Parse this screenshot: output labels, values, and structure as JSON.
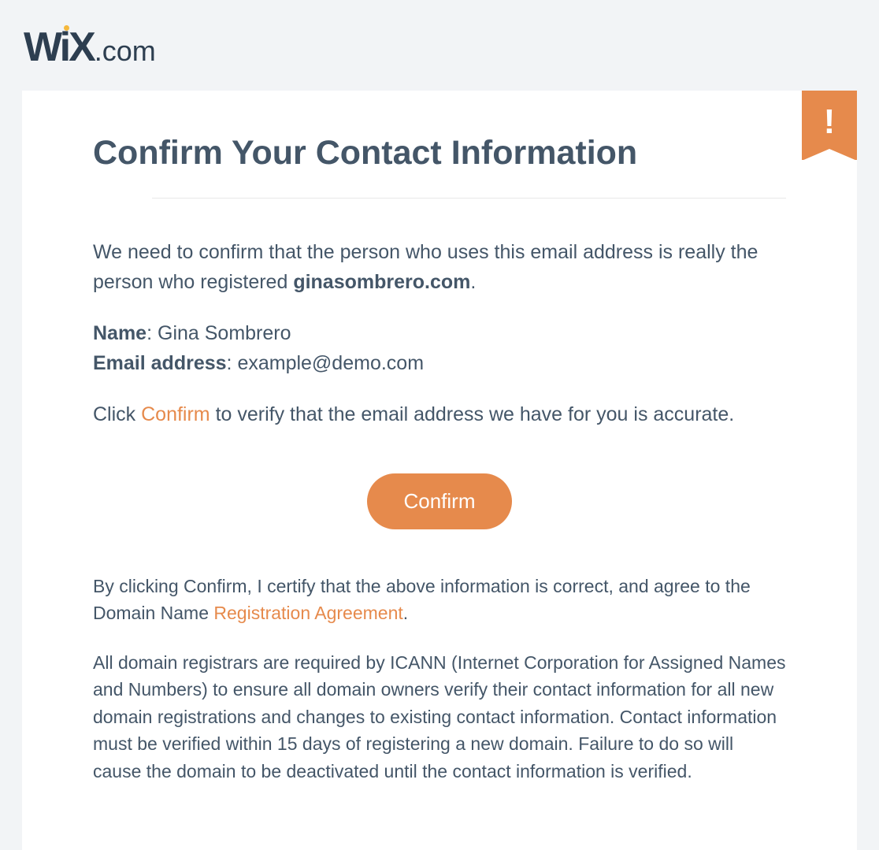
{
  "logo": {
    "wix": "WiX",
    "com": ".com"
  },
  "ribbon": {
    "icon": "!"
  },
  "title": "Confirm Your Contact Information",
  "intro": {
    "prefix": "We need to confirm that the person who uses this email address is really the person who registered ",
    "domain": "ginasombrero.com",
    "suffix": "."
  },
  "name": {
    "label": "Name",
    "value": "Gina Sombrero"
  },
  "email": {
    "label": "Email address",
    "value": "example@demo.com"
  },
  "instruction": {
    "prefix": "Click ",
    "link": "Confirm",
    "suffix": " to verify that the email address we have for you is accurate."
  },
  "button": {
    "label": "Confirm"
  },
  "certify": {
    "prefix": "By clicking Confirm, I certify that the above information is correct, and agree to the Domain Name ",
    "link": "Registration Agreement",
    "suffix": "."
  },
  "icann": "All domain registrars are required by ICANN (Internet Corporation for Assigned Names and Numbers) to ensure all domain owners verify their contact information for all new domain registrations and changes to existing contact information. Contact information must be verified within 15 days of registering a new domain. Failure to do so will cause the domain to be deactivated until the contact information is verified."
}
